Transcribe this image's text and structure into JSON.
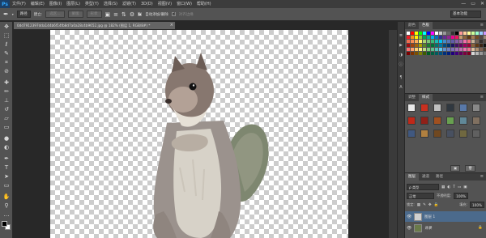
{
  "app": {
    "logo": "Ps"
  },
  "menu": [
    "文件(F)",
    "编辑(E)",
    "图像(I)",
    "图层(L)",
    "类型(Y)",
    "选择(S)",
    "滤镜(T)",
    "3D(D)",
    "视图(V)",
    "窗口(W)",
    "帮助(H)"
  ],
  "window_controls": [
    "—",
    "▭",
    "✕"
  ],
  "options": {
    "mode_value": "路径",
    "make_label": "建立:",
    "selection_btn": "选区...",
    "mask_btn": "蒙版",
    "shape_btn": "形状",
    "auto_add_delete": "自动添加/删除",
    "align_edges": "对齐边缘",
    "workspace": "基本功能"
  },
  "document": {
    "tab_title": "0dd7912397dda144b6f14fb8d7a0a28c4b9652.jpg @ 182% (图层 1, RGB/8#) *",
    "close": "×"
  },
  "tools": [
    "move",
    "marquee",
    "lasso",
    "quick-select",
    "crop",
    "eyedropper",
    "healing",
    "brush",
    "stamp",
    "history-brush",
    "eraser",
    "gradient",
    "dodge",
    "pen",
    "type",
    "path-select",
    "shape",
    "hand",
    "zoom"
  ],
  "swatches_panel": {
    "tabs": [
      "颜色",
      "色板"
    ],
    "active_tab": "色板",
    "rows": [
      [
        "#ffffff",
        "#ff0000",
        "#ffff00",
        "#00ff00",
        "#00ffff",
        "#0000ff",
        "#ff00ff",
        "#ffffff",
        "#cccccc",
        "#999999",
        "#666666",
        "#333333",
        "#000000",
        "#ff9999",
        "#ffcc99",
        "#ffff99",
        "#ccff99",
        "#99ffcc",
        "#99ccff",
        "#cc99ff"
      ],
      [
        "#ee1d24",
        "#f7941d",
        "#fff200",
        "#8dc63f",
        "#00a651",
        "#00a99d",
        "#00aeef",
        "#0072bc",
        "#2e3192",
        "#662d91",
        "#92278f",
        "#ec008c",
        "#ed145b",
        "#c69c6d",
        "#8c6239",
        "#603913",
        "#a67c52",
        "#754c24",
        "#534741",
        "#998675"
      ],
      [
        "#f26c4f",
        "#f68e55",
        "#fbaf5c",
        "#fff467",
        "#acd372",
        "#7cc576",
        "#3bb878",
        "#1abbb4",
        "#00bff3",
        "#438ccb",
        "#5574b9",
        "#605ca8",
        "#855fa8",
        "#a763a8",
        "#f06ea9",
        "#f26d7d",
        "#c7b299",
        "#736357",
        "#362f2d",
        "#534741"
      ],
      [
        "#9e0b0f",
        "#a0410d",
        "#a3620a",
        "#aba000",
        "#598527",
        "#1a7b30",
        "#007236",
        "#00746b",
        "#0076a3",
        "#004b80",
        "#003471",
        "#1b1464",
        "#440e62",
        "#630460",
        "#9e005d",
        "#9e0039",
        "#8c6239",
        "#603913",
        "#3c2415",
        "#111111"
      ],
      [
        "#ff6f6f",
        "#ffa070",
        "#ffd070",
        "#fff08a",
        "#c0e080",
        "#80d080",
        "#60c090",
        "#50c0c0",
        "#60c8f0",
        "#6090d0",
        "#7080c0",
        "#8070b8",
        "#a070b8",
        "#c070b0",
        "#f070b0",
        "#f07090",
        "#e0c0a0",
        "#b09070",
        "#806050",
        "#504030"
      ],
      [
        "#7d0000",
        "#7d3000",
        "#7d5000",
        "#7d7d00",
        "#3d5d00",
        "#005d20",
        "#005d40",
        "#005d5d",
        "#00507d",
        "#00307d",
        "#00207d",
        "#20007d",
        "#40007d",
        "#5d005d",
        "#7d0040",
        "#7d0020",
        "#d8d8d8",
        "#b8b8b8",
        "#989898",
        "#787878"
      ]
    ]
  },
  "styles_panel": {
    "tabs": [
      "调整",
      "样式"
    ],
    "active_tab": "样式",
    "rows": [
      [
        "#e8e8e8",
        "#c83020",
        "#c0c0c0",
        "#303840",
        "#5878a8",
        "#888888"
      ],
      [
        "#c02818",
        "#902018",
        "#a05020",
        "#68a050",
        "#608898",
        "#807060"
      ],
      [
        "#405880",
        "#b08040",
        "#704820",
        "#485060",
        "#706840",
        "#606060"
      ]
    ]
  },
  "layers_panel": {
    "tabs": [
      "图层",
      "通道",
      "路径"
    ],
    "active_tab": "图层",
    "kind_label": "ρ 类型",
    "blend_mode": "正常",
    "opacity_label": "不透明度:",
    "opacity_value": "100%",
    "lock_label": "锁定:",
    "fill_label": "填充:",
    "fill_value": "100%",
    "layers": [
      {
        "name": "图层 1",
        "selected": true,
        "visible": true
      },
      {
        "name": "背景",
        "selected": false,
        "visible": true,
        "locked": true
      }
    ],
    "eye_icon": "👁",
    "lock_icon": "🔒"
  },
  "dock_buttons": [
    "history",
    "actions",
    "adjust",
    "info",
    "paragraph",
    "char"
  ],
  "colors": {
    "ui_dark": "#282828",
    "ui_panel": "#535353",
    "ui_bar": "#3c3c3c",
    "ps_accent": "#31a8ff",
    "selected_layer": "#4b6a8c"
  }
}
